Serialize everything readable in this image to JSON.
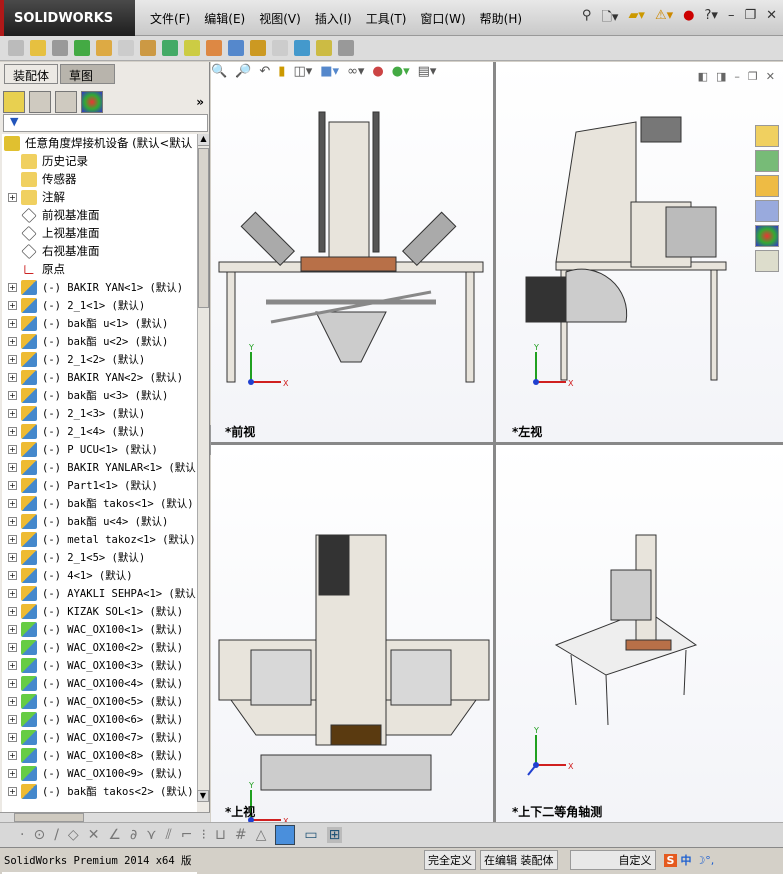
{
  "app": {
    "logo": "SOLIDWORKS",
    "menu": [
      "文件(F)",
      "编辑(E)",
      "视图(V)",
      "插入(I)",
      "工具(T)",
      "窗口(W)",
      "帮助(H)"
    ]
  },
  "panel": {
    "tabs": [
      "装配体",
      "草图"
    ],
    "more": "»",
    "filter_icon": "funnel-icon"
  },
  "tree": {
    "root": "任意角度焊接机设备  (默认<默认",
    "fixed": [
      {
        "label": "历史记录",
        "icon": "history-folder-icon"
      },
      {
        "label": "传感器",
        "icon": "sensor-folder-icon"
      },
      {
        "label": "注解",
        "icon": "annotation-icon",
        "expand": true
      },
      {
        "label": "前视基准面",
        "icon": "plane-icon"
      },
      {
        "label": "上视基准面",
        "icon": "plane-icon"
      },
      {
        "label": "右视基准面",
        "icon": "plane-icon"
      },
      {
        "label": "原点",
        "icon": "origin-icon"
      }
    ],
    "parts": [
      "(-) BAKIR YAN<1> (默认)",
      "(-) 2_1<1> (默认)",
      "(-) bak酯 u<1> (默认)",
      "(-) bak酯 u<2> (默认)",
      "(-) 2_1<2> (默认)",
      "(-) BAKIR YAN<2> (默认)",
      "(-) bak酯 u<3> (默认)",
      "(-) 2_1<3> (默认)",
      "(-) 2_1<4> (默认)",
      "(-) P UCU<1> (默认)",
      "(-) BAKIR YANLAR<1> (默认",
      "(-) Part1<1> (默认)",
      "(-) bak酯 takos<1> (默认)",
      "(-) bak酯 u<4> (默认)",
      "(-) metal takoz<1> (默认)",
      "(-) 2_1<5> (默认)",
      "(-) 4<1> (默认)",
      "(-) AYAKLI SEHPA<1> (默认",
      "(-) KIZAK SOL<1> (默认)",
      "(-) WAC_OX100<1> (默认)",
      "(-) WAC_OX100<2> (默认)",
      "(-) WAC_OX100<3> (默认)",
      "(-) WAC_OX100<4> (默认)",
      "(-) WAC_OX100<5> (默认)",
      "(-) WAC_OX100<6> (默认)",
      "(-) WAC_OX100<7> (默认)",
      "(-) WAC_OX100<8> (默认)",
      "(-) WAC_OX100<9> (默认)",
      "(-) bak酯 takos<2> (默认)"
    ]
  },
  "viewports": {
    "front": "*前视",
    "left": "*左视",
    "top": "*上视",
    "iso": "*上下二等角轴测"
  },
  "axes": {
    "x": "X",
    "y": "Y",
    "z": "Z"
  },
  "status": {
    "product": "SolidWorks Premium 2014 x64 版",
    "defined": "完全定义",
    "editing": "在编辑 装配体",
    "units": "自定义",
    "ime": "中"
  },
  "colors": {
    "logo_bg": "#2a2a2a",
    "logo_accent": "#b01818",
    "viewport_bg": "#ffffff",
    "axis_x": "#d02020",
    "axis_y": "#20a020",
    "axis_z": "#2040d0"
  }
}
